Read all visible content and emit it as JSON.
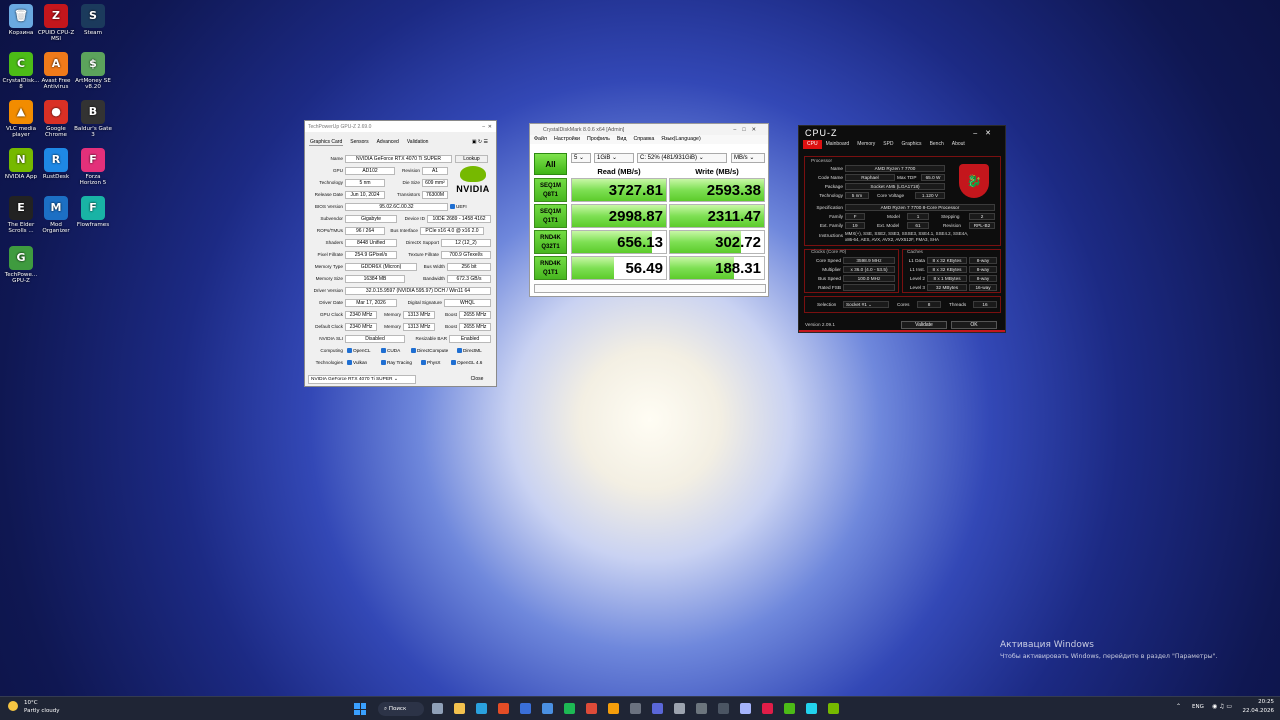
{
  "desktop": {
    "icons": [
      {
        "label": "Корзина",
        "color": "#6aa9e0",
        "glyph": "🗑"
      },
      {
        "label": "CPUID CPU-Z MSI",
        "color": "#c4161c",
        "glyph": "Z"
      },
      {
        "label": "Steam",
        "color": "#1b3a5c",
        "glyph": "S"
      },
      {
        "label": "CrystalDisk... 8",
        "color": "#4cbb17",
        "glyph": "C"
      },
      {
        "label": "Avast Free Antivirus",
        "color": "#f07a1a",
        "glyph": "A"
      },
      {
        "label": "ArtMoney SE v8.20",
        "color": "#5ca35c",
        "glyph": "$"
      },
      {
        "label": "VLC media player",
        "color": "#f28c00",
        "glyph": "▲"
      },
      {
        "label": "Google Chrome",
        "color": "#d93025",
        "glyph": "●"
      },
      {
        "label": "Baldur's Gate 3",
        "color": "#333333",
        "glyph": "B"
      },
      {
        "label": "NVIDIA App",
        "color": "#76b900",
        "glyph": "N"
      },
      {
        "label": "RustDesk",
        "color": "#1e88e5",
        "glyph": "R"
      },
      {
        "label": "Forza Horizon 5",
        "color": "#e3307a",
        "glyph": "F"
      },
      {
        "label": "The Elder Scrolls ...",
        "color": "#222222",
        "glyph": "E"
      },
      {
        "label": "Mod Organizer",
        "color": "#1c6fc4",
        "glyph": "M"
      },
      {
        "label": "Flowframes",
        "color": "#19b3a5",
        "glyph": "F"
      },
      {
        "label": "TechPowe... GPU-Z",
        "color": "#3f9b3f",
        "glyph": "G"
      }
    ]
  },
  "gpuz": {
    "title": "TechPowerUp GPU-Z 2.69.0",
    "tabs": [
      "Graphics Card",
      "Sensors",
      "Advanced",
      "Validation"
    ],
    "name_label": "Name",
    "name": "NVIDIA GeForce RTX 4070 Ti SUPER",
    "lookup": "Lookup",
    "gpu_label": "GPU",
    "gpu": "AD102",
    "revision_label": "Revision",
    "revision": "A1",
    "technology_label": "Technology",
    "technology": "5 nm",
    "die_size_label": "Die Size",
    "die_size": "609 mm²",
    "release_label": "Release Date",
    "release": "Jun 10, 2024",
    "transistors_label": "Transistors",
    "transistors": "76300M",
    "bios_label": "BIOS Version",
    "bios": "95.02.6C.00.32",
    "uefi": "UEFI",
    "subvendor_label": "Subvendor",
    "subvendor": "Gigabyte",
    "device_id_label": "Device ID",
    "device_id": "10DE 2689 - 1458 4162",
    "rops_label": "ROPs/TMUs",
    "rops": "96 / 264",
    "bus_label": "Bus Interface",
    "bus": "PCIe x16 4.0 @ x16 2.0",
    "shaders_label": "Shaders",
    "shaders": "8448 Unified",
    "directx_label": "DirectX Support",
    "directx": "12 (12_2)",
    "pixel_label": "Pixel Fillrate",
    "pixel": "254.9 GPixel/s",
    "texture_label": "Texture Fillrate",
    "texture": "700.9 GTexel/s",
    "memtype_label": "Memory Type",
    "memtype": "GDDR6X (Micron)",
    "buswidth_label": "Bus Width",
    "buswidth": "256 bit",
    "memsize_label": "Memory Size",
    "memsize": "16384 MB",
    "bandwidth_label": "Bandwidth",
    "bandwidth": "672.3 GB/s",
    "driver_label": "Driver Version",
    "driver": "32.0.15.9597 (NVIDIA 595.97) DCH / Win11 64",
    "driverdate_label": "Driver Date",
    "driverdate": "Mar 17, 2026",
    "signature_label": "Digital Signature",
    "signature": "WHQL",
    "gpuclock_label": "GPU Clock",
    "gpuclock": "2340 MHz",
    "memory_label": "Memory",
    "memclock": "1313 MHz",
    "boost_label": "Boost",
    "boost": "2655 MHz",
    "defclock_label": "Default Clock",
    "defclock": "2340 MHz",
    "defmem": "1313 MHz",
    "defboost": "2655 MHz",
    "sli_label": "NVIDIA SLI",
    "sli": "Disabled",
    "rebar_label": "Resizable BAR",
    "rebar": "Enabled",
    "computing_label": "Computing",
    "computing": [
      "OpenCL",
      "CUDA",
      "DirectCompute",
      "DirectML"
    ],
    "tech_label": "Technologies",
    "technologies": [
      "Vulkan",
      "Ray Tracing",
      "PhysX",
      "OpenGL 4.6"
    ],
    "logo_text": "NVIDIA",
    "selected_card": "NVIDIA GeForce RTX 4070 Ti SUPER",
    "close": "Close"
  },
  "cdm": {
    "title": "CrystalDiskMark 8.0.6 x64 [Admin]",
    "menu": [
      "Файл",
      "Настройки",
      "Профиль",
      "Вид",
      "Справка",
      "Язык(Language)"
    ],
    "all": "All",
    "count": "5",
    "size": "1GiB",
    "drive": "C: 52% (481/931GiB)",
    "unit": "MB/s",
    "read_header": "Read (MB/s)",
    "write_header": "Write (MB/s)",
    "tests": [
      {
        "l1": "SEQ1M",
        "l2": "Q8T1",
        "read": "3727.81",
        "write": "2593.38",
        "read_frac": 1.0,
        "write_frac": 1.0
      },
      {
        "l1": "SEQ1M",
        "l2": "Q1T1",
        "read": "2998.87",
        "write": "2311.47",
        "read_frac": 1.0,
        "write_frac": 1.0
      },
      {
        "l1": "RND4K",
        "l2": "Q32T1",
        "read": "656.13",
        "write": "302.72",
        "read_frac": 0.85,
        "write_frac": 0.75
      },
      {
        "l1": "RND4K",
        "l2": "Q1T1",
        "read": "56.49",
        "write": "188.31",
        "read_frac": 0.45,
        "write_frac": 0.68
      }
    ]
  },
  "cpuz": {
    "title": "CPU-Z",
    "tabs": [
      "CPU",
      "Mainboard",
      "Memory",
      "SPD",
      "Graphics",
      "Bench",
      "About"
    ],
    "processor_label": "Processor",
    "name_label": "Name",
    "name": "AMD Ryzen 7 7700",
    "codename_label": "Code Name",
    "codename": "Raphael",
    "maxtdp_label": "Max TDP",
    "maxtdp": "65.0 W",
    "package_label": "Package",
    "package": "Socket AM5 (LGA1718)",
    "tech_label": "Technology",
    "tech": "5 nm",
    "voltage_label": "Core Voltage",
    "voltage": "1.120 V",
    "spec_label": "Specification",
    "spec": "AMD Ryzen 7 7700 8-Core Processor",
    "family_label": "Family",
    "family": "F",
    "model_label": "Model",
    "model": "1",
    "stepping_label": "Stepping",
    "stepping": "2",
    "extfamily_label": "Ext. Family",
    "extfamily": "19",
    "extmodel_label": "Ext. Model",
    "extmodel": "61",
    "revision_label": "Revision",
    "revision": "RPL-B2",
    "instr_label": "Instructions",
    "instr1": "MMX(+), SSE, SSE2, SSE3, SSSE3, SSE4.1, SSE4.2, SSE4A,",
    "instr2": "x86-64, AES, AVX, AVX2, AVX512F, FMA3, SHA",
    "clocks_label": "Clocks (Core #0)",
    "corespeed_label": "Core Speed",
    "corespeed": "3598.9 MHz",
    "multiplier_label": "Multiplier",
    "multiplier": "x 36.0 (4.0 - 53.5)",
    "busspeed_label": "Bus Speed",
    "busspeed": "100.0 MHz",
    "ratedfsb_label": "Rated FSB",
    "ratedfsb": "",
    "caches_label": "Caches",
    "l1d_label": "L1 Data",
    "l1d": "8 x 32 KBytes",
    "l1d_way": "8-way",
    "l1i_label": "L1 Inst.",
    "l1i": "8 x 32 KBytes",
    "l1i_way": "8-way",
    "l2_label": "Level 2",
    "l2": "8 x 1 MBytes",
    "l2_way": "8-way",
    "l3_label": "Level 3",
    "l3": "32 MBytes",
    "l3_way": "16-way",
    "selection_label": "Selection",
    "selection": "Socket #1",
    "cores_label": "Cores",
    "cores": "8",
    "threads_label": "Threads",
    "threads": "16",
    "version": "Version 2.09.1",
    "validate": "Validate",
    "ok": "OK"
  },
  "activation": {
    "line1": "Активация Windows",
    "line2": "Чтобы активировать Windows, перейдите в раздел \"Параметры\"."
  },
  "taskbar": {
    "weather_temp": "10°C",
    "weather_desc": "Partly cloudy",
    "search": "Поиск",
    "lang": "ENG",
    "time": "20:25",
    "date": "22.04.2026"
  },
  "colors": {
    "accent_green": "#4cbb17",
    "cpuz_red": "#c4161c",
    "nvidia_green": "#76b900"
  }
}
